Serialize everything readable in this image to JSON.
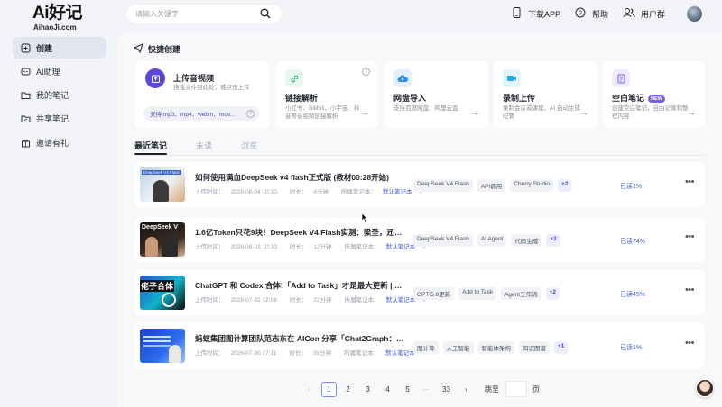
{
  "brand": {
    "logo_text": "Ai好记",
    "sub": "AihaoJi.com"
  },
  "nav": [
    {
      "label": "创建",
      "icon": "create-icon"
    },
    {
      "label": "AI助理",
      "icon": "ai-assistant-icon"
    },
    {
      "label": "我的笔记",
      "icon": "folder-icon"
    },
    {
      "label": "共享笔记",
      "icon": "share-folder-icon"
    },
    {
      "label": "邀请有礼",
      "icon": "gift-icon"
    }
  ],
  "search": {
    "placeholder": "请输入关键字"
  },
  "header": {
    "download": "下载APP",
    "help": "帮助",
    "group": "用户群"
  },
  "quick_create": {
    "title": "快捷创建",
    "upload": {
      "title": "上传音视频",
      "desc": "拖拽文件到此处，或点击上传",
      "formats": "支持 mp3、mp4、webm、mov..."
    },
    "cards": [
      {
        "title": "链接解析",
        "desc": "小红书、BiliBili、小宇宙、抖音等音视频链接解析",
        "color": "#22b573"
      },
      {
        "title": "网盘导入",
        "desc": "支持百度网盘、阿里云盘",
        "color": "#2f8bf0"
      },
      {
        "title": "录制上传",
        "desc": "录制会议或课程，AI 自动生成纪要",
        "color": "#1fa8e8"
      },
      {
        "title": "空白笔记",
        "desc": "创建空白笔记，自由记录和整理内容",
        "badge": "NEW",
        "color": "#7a5df0"
      }
    ]
  },
  "tabs": [
    "最近笔记",
    "未读",
    "浏览"
  ],
  "notes": [
    {
      "title": "如何使用满血DeepSeek v4 flash正式版 (教材00:28开始)",
      "uploaded_label": "上传时间：",
      "uploaded": "2026-08-04 10:30",
      "duration_label": "时长：",
      "duration": "4分钟",
      "notebook_label": "所属笔记本：",
      "notebook": "默认笔记本",
      "tags": [
        "DeepSeek V4 Flash",
        "API调用",
        "Cherry Studio"
      ],
      "more": "+2",
      "progress": "已读1%"
    },
    {
      "title": "1.6亿Token只花9块！DeepSeek V4 Flash实测：梁圣，还是梁子?",
      "uploaded_label": "上传时间：",
      "uploaded": "2026-08-03 10:30",
      "duration_label": "时长：",
      "duration": "13分钟",
      "notebook_label": "所属笔记本：",
      "notebook": "默认笔记本",
      "tags": [
        "DeepSeek V4 Flash",
        "AI Agent",
        "代码生成"
      ],
      "more": "+2",
      "progress": "已读74%"
    },
    {
      "title": "ChatGPT 和 Codex 合体!「Add to Task」才是最大更新 | GPT5...",
      "uploaded_label": "上传时间：",
      "uploaded": "2026-07-31 12:08",
      "duration_label": "时长：",
      "duration": "22分钟",
      "notebook_label": "所属笔记本：",
      "notebook": "默认笔记本",
      "tags": [
        "GPT-5.6更新",
        "Add to Task",
        "Agent工作流"
      ],
      "more": "+2",
      "progress": "已读45%"
    },
    {
      "title": "蚂蚁集团图计算团队范志东在 AICon 分享「Chat2Graph：Graph ...",
      "uploaded_label": "上传时间：",
      "uploaded": "2026-07-30 17:11",
      "duration_label": "时长：",
      "duration": "39分钟",
      "notebook_label": "所属笔记本：",
      "notebook": "默认笔记本",
      "tags": [
        "图计算",
        "人工智能",
        "智能体架构",
        "知识图谱"
      ],
      "more": "+1",
      "progress": "已读1%"
    }
  ],
  "thumb_texts": [
    "DeepSeek V4 Flash",
    "DeepSeek V",
    "佬子合体",
    ""
  ],
  "pagination": {
    "prev": "‹",
    "pages": [
      "1",
      "2",
      "3",
      "4",
      "5"
    ],
    "ellipsis": "···",
    "last": "33",
    "next": "›",
    "jump_label": "跳至",
    "page_unit": "页",
    "current": "1"
  },
  "colors": {
    "accent": "#3d4ad0",
    "sidebar_active": "#e1e5ef",
    "upload_icon": "#5a48d6"
  }
}
